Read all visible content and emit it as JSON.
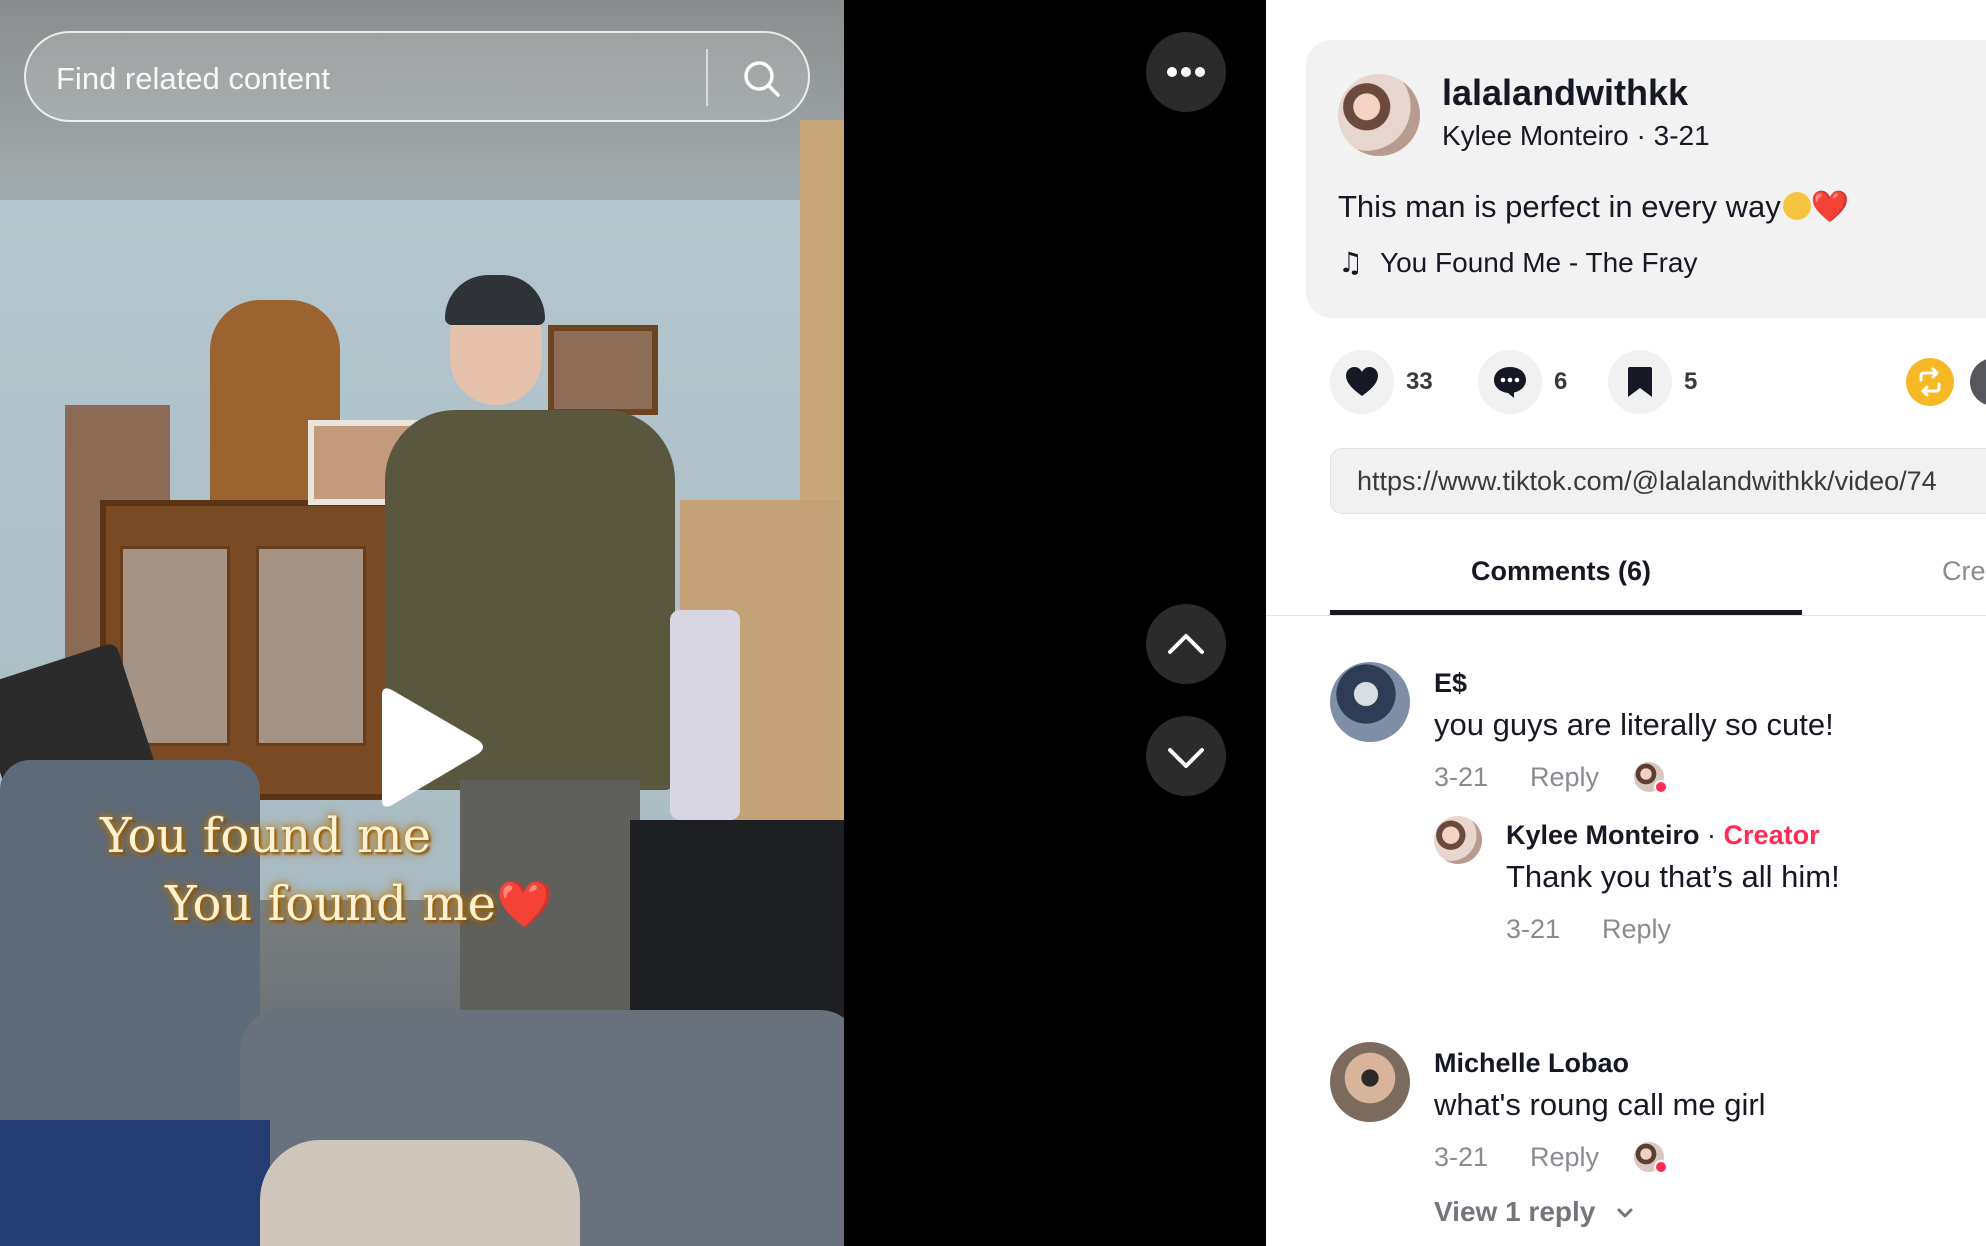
{
  "search": {
    "placeholder": "Find related content"
  },
  "video": {
    "caption_lines": [
      "You found me",
      "You found me"
    ],
    "caption_emoji": "❤️"
  },
  "post": {
    "handle": "lalalandwithkk",
    "display_name": "Kylee Monteiro",
    "date": "3-21",
    "description": "This man is perfect in every way",
    "description_emoji": "❤️",
    "music": "You Found Me - The Fray"
  },
  "actions": {
    "likes": "33",
    "comments": "6",
    "saves": "5"
  },
  "share_url": "https://www.tiktok.com/@lalalandwithkk/video/74",
  "tabs": [
    "Comments (6)",
    "Cre"
  ],
  "comments": [
    {
      "name": "E$",
      "text": "you guys are literally so cute!",
      "date": "3-21",
      "reply_label": "Reply",
      "reply": {
        "name": "Kylee Monteiro",
        "badge": "Creator",
        "text": "Thank you that’s all him!",
        "date": "3-21",
        "reply_label": "Reply"
      }
    },
    {
      "name": "Michelle Lobao",
      "text": "what's roung call me girl",
      "date": "3-21",
      "reply_label": "Reply",
      "view_replies": "View 1 reply"
    }
  ],
  "colors": {
    "creator": "#fe2c55",
    "share": "#f7b825",
    "text": "#161823",
    "muted": "#8a8b91"
  },
  "icons": [
    "search-icon",
    "play-icon",
    "more-icon",
    "chevron-up-icon",
    "chevron-down-icon",
    "music-note-icon",
    "heart-icon",
    "comment-icon",
    "bookmark-icon",
    "repost-icon"
  ]
}
